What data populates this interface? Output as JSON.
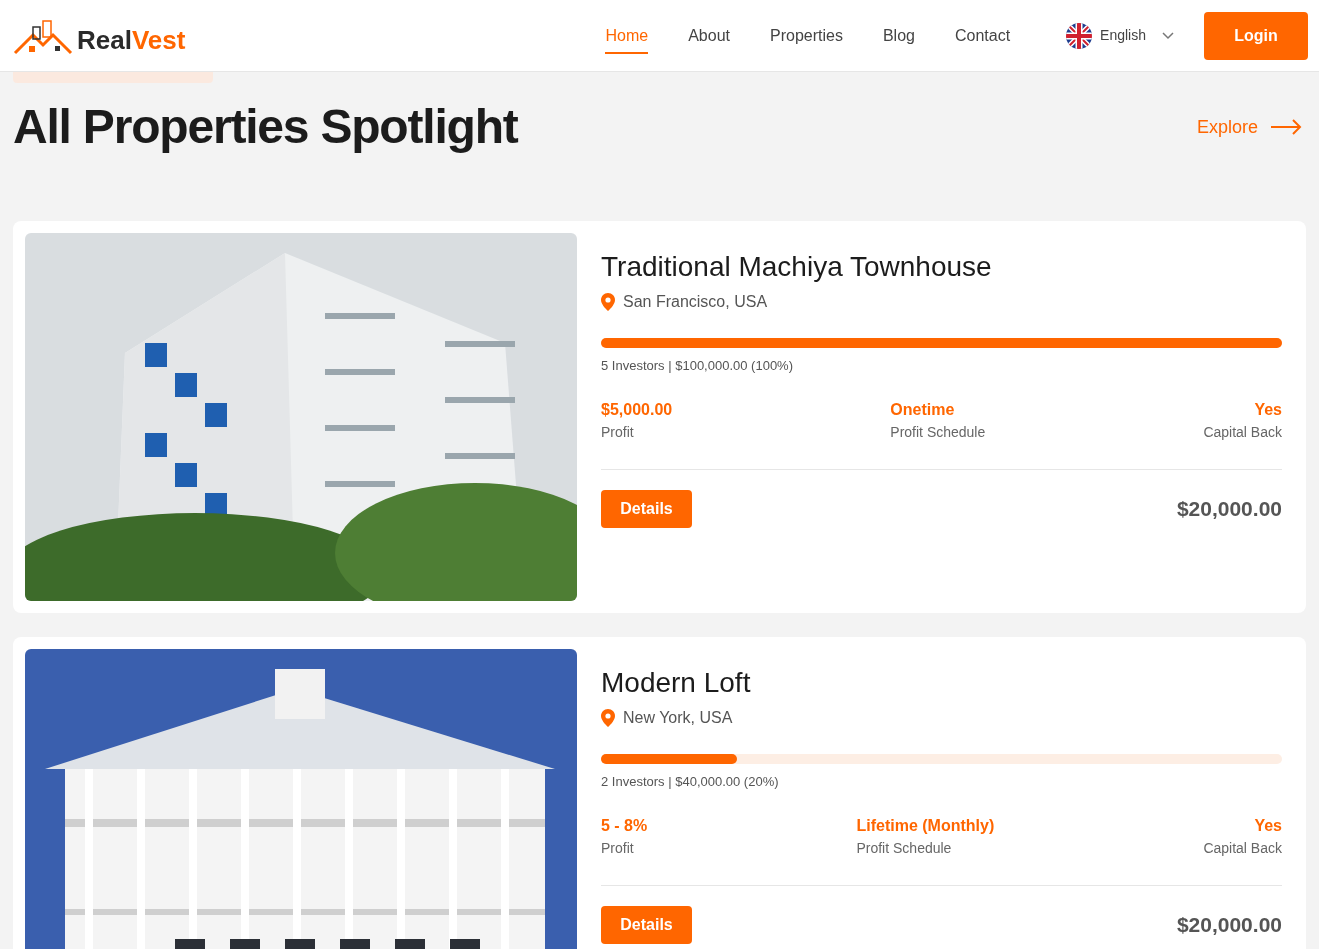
{
  "brand": {
    "part_1": "Real",
    "part_2": "Vest"
  },
  "nav": [
    {
      "label": "Home",
      "selected": true
    },
    {
      "label": "About",
      "selected": false
    },
    {
      "label": "Properties",
      "selected": false
    },
    {
      "label": "Blog",
      "selected": false
    },
    {
      "label": "Contact",
      "selected": false
    }
  ],
  "language": "English",
  "login": "Login",
  "heading": "All Properties Spotlight",
  "explore": "Explore",
  "properties": [
    {
      "title": "Traditional Machiya Townhouse",
      "location": "San Francisco, USA",
      "level": 1,
      "investors": "5 Investors | $100,000.00 (100%)",
      "stats": [
        {
          "value": "$5,000.00",
          "label": "Profit"
        },
        {
          "value": "Onetime",
          "label": "Profit Schedule"
        },
        {
          "value": "Yes",
          "label": "Capital Back"
        }
      ],
      "button": "Details",
      "price": "$20,000.00"
    },
    {
      "title": "Modern Loft",
      "location": "New York, USA",
      "level": 0.2,
      "investors": "2 Investors | $40,000.00 (20%)",
      "stats": [
        {
          "value": "5 - 8%",
          "label": "Profit"
        },
        {
          "value": "Lifetime (Monthly)",
          "label": "Profit Schedule"
        },
        {
          "value": "Yes",
          "label": "Capital Back"
        }
      ],
      "button": "Details",
      "price": "$20,000.00"
    }
  ]
}
